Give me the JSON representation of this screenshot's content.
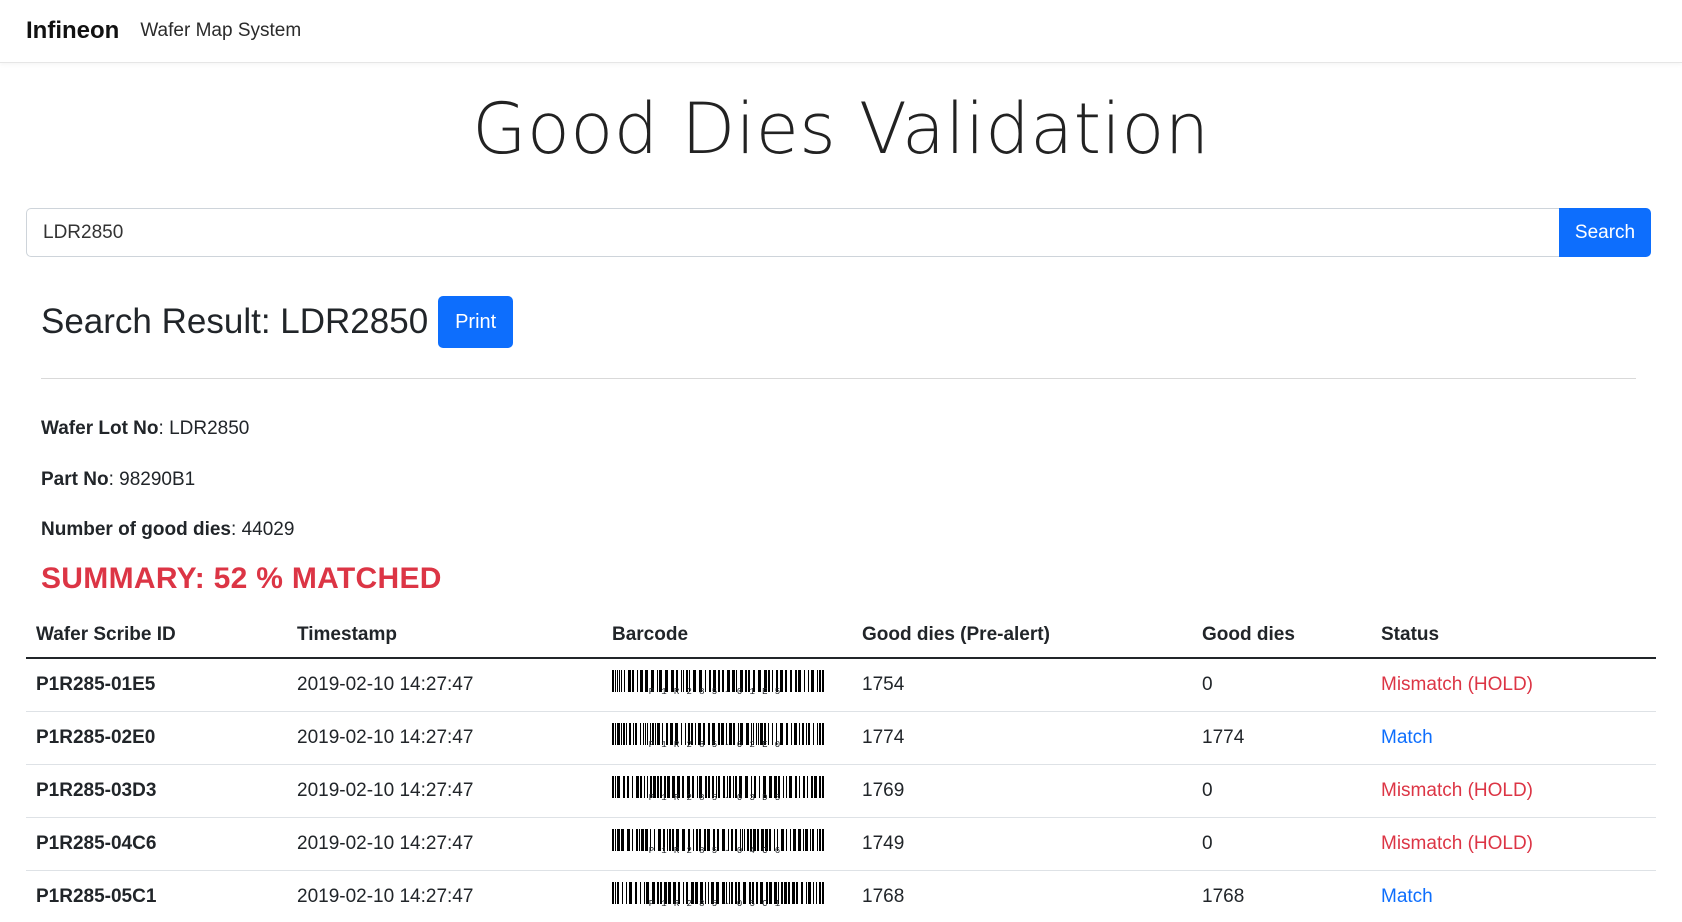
{
  "navbar": {
    "brand": "Infineon",
    "link": "Wafer Map System"
  },
  "page_title": "Good Dies Validation",
  "search": {
    "value": "LDR2850",
    "button_label": "Search"
  },
  "result": {
    "title": "Search Result: LDR2850",
    "print_label": "Print"
  },
  "info": {
    "lot_label": "Wafer Lot No",
    "lot_value": "LDR2850",
    "part_label": "Part No",
    "part_value": "98290B1",
    "dies_label": "Number of good dies",
    "dies_value": "44029"
  },
  "summary": "SUMMARY: 52 % MATCHED",
  "table": {
    "headers": [
      "Wafer Scribe ID",
      "Timestamp",
      "Barcode",
      "Good dies (Pre-alert)",
      "Good dies",
      "Status"
    ],
    "rows": [
      {
        "scribe": "P1R285-01E5",
        "timestamp": "2019-02-10 14:27:47",
        "barcode": "P1R285-01E5",
        "prealert": "1754",
        "good": "0",
        "status": "Mismatch (HOLD)"
      },
      {
        "scribe": "P1R285-02E0",
        "timestamp": "2019-02-10 14:27:47",
        "barcode": "P1R285-02E0",
        "prealert": "1774",
        "good": "1774",
        "status": "Match"
      },
      {
        "scribe": "P1R285-03D3",
        "timestamp": "2019-02-10 14:27:47",
        "barcode": "P1R285-03D3",
        "prealert": "1769",
        "good": "0",
        "status": "Mismatch (HOLD)"
      },
      {
        "scribe": "P1R285-04C6",
        "timestamp": "2019-02-10 14:27:47",
        "barcode": "P1R285-04C6",
        "prealert": "1749",
        "good": "0",
        "status": "Mismatch (HOLD)"
      },
      {
        "scribe": "P1R285-05C1",
        "timestamp": "2019-02-10 14:27:47",
        "barcode": "P1R285-05C1",
        "prealert": "1768",
        "good": "1768",
        "status": "Match"
      }
    ]
  },
  "colors": {
    "primary": "#0d6efd",
    "danger": "#dc3545"
  }
}
